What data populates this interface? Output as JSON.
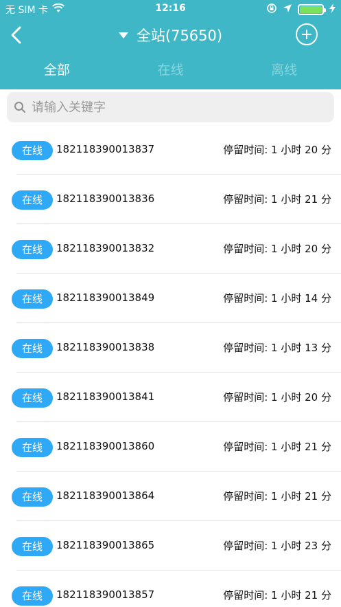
{
  "status_bar": {
    "carrier": "无 SIM 卡",
    "time": "12:16",
    "icons": [
      "wifi-icon",
      "orientation-lock-icon",
      "location-arrow-icon",
      "battery-icon",
      "charging-bolt-icon"
    ]
  },
  "nav": {
    "back_icon": "chevron-left-icon",
    "station_label": "全站(75650)",
    "add_icon": "plus-circle-icon"
  },
  "tabs": [
    {
      "label": "全部",
      "active": true
    },
    {
      "label": "在线",
      "active": false
    },
    {
      "label": "离线",
      "active": false
    }
  ],
  "search": {
    "placeholder": "请输入关键字",
    "value": ""
  },
  "colors": {
    "header": "#3fb7c6",
    "badge": "#2fa9f5",
    "tab_inactive": "#88d6df",
    "battery": "#7be05a"
  },
  "devices": [
    {
      "status": "在线",
      "id": "182118390013837",
      "stay": "停留时间: 1 小时 20 分"
    },
    {
      "status": "在线",
      "id": "182118390013836",
      "stay": "停留时间: 1 小时 21 分"
    },
    {
      "status": "在线",
      "id": "182118390013832",
      "stay": "停留时间: 1 小时 20 分"
    },
    {
      "status": "在线",
      "id": "182118390013849",
      "stay": "停留时间: 1 小时 14 分"
    },
    {
      "status": "在线",
      "id": "182118390013838",
      "stay": "停留时间: 1 小时 13 分"
    },
    {
      "status": "在线",
      "id": "182118390013841",
      "stay": "停留时间: 1 小时 20 分"
    },
    {
      "status": "在线",
      "id": "182118390013860",
      "stay": "停留时间: 1 小时 21 分"
    },
    {
      "status": "在线",
      "id": "182118390013864",
      "stay": "停留时间: 1 小时 21 分"
    },
    {
      "status": "在线",
      "id": "182118390013865",
      "stay": "停留时间: 1 小时 23 分"
    },
    {
      "status": "在线",
      "id": "182118390013857",
      "stay": "停留时间: 1 小时 21 分"
    }
  ]
}
